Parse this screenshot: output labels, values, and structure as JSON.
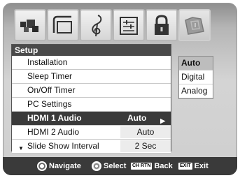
{
  "tabs": [
    {
      "icon": "picture-icon",
      "active": false
    },
    {
      "icon": "screen-icon",
      "active": false
    },
    {
      "icon": "audio-icon",
      "active": false
    },
    {
      "icon": "preferences-icon",
      "active": false
    },
    {
      "icon": "lock-icon",
      "active": false
    },
    {
      "icon": "setup-icon",
      "active": true
    }
  ],
  "menu": {
    "title": "Setup",
    "items": [
      {
        "label": "Installation",
        "value": ""
      },
      {
        "label": "Sleep Timer",
        "value": ""
      },
      {
        "label": "On/Off Timer",
        "value": ""
      },
      {
        "label": "PC Settings",
        "value": ""
      },
      {
        "label": "HDMI 1 Audio",
        "value": "Auto",
        "selected": true
      },
      {
        "label": "HDMI 2 Audio",
        "value": "Auto"
      },
      {
        "label": "Slide Show Interval",
        "value": "2 Sec"
      }
    ]
  },
  "options": [
    "Auto",
    "Digital",
    "Analog"
  ],
  "footer": {
    "navigate": "Navigate",
    "select": "Select",
    "back_key": "CH RTN",
    "back": "Back",
    "exit_key": "EXIT",
    "exit": "Exit"
  }
}
